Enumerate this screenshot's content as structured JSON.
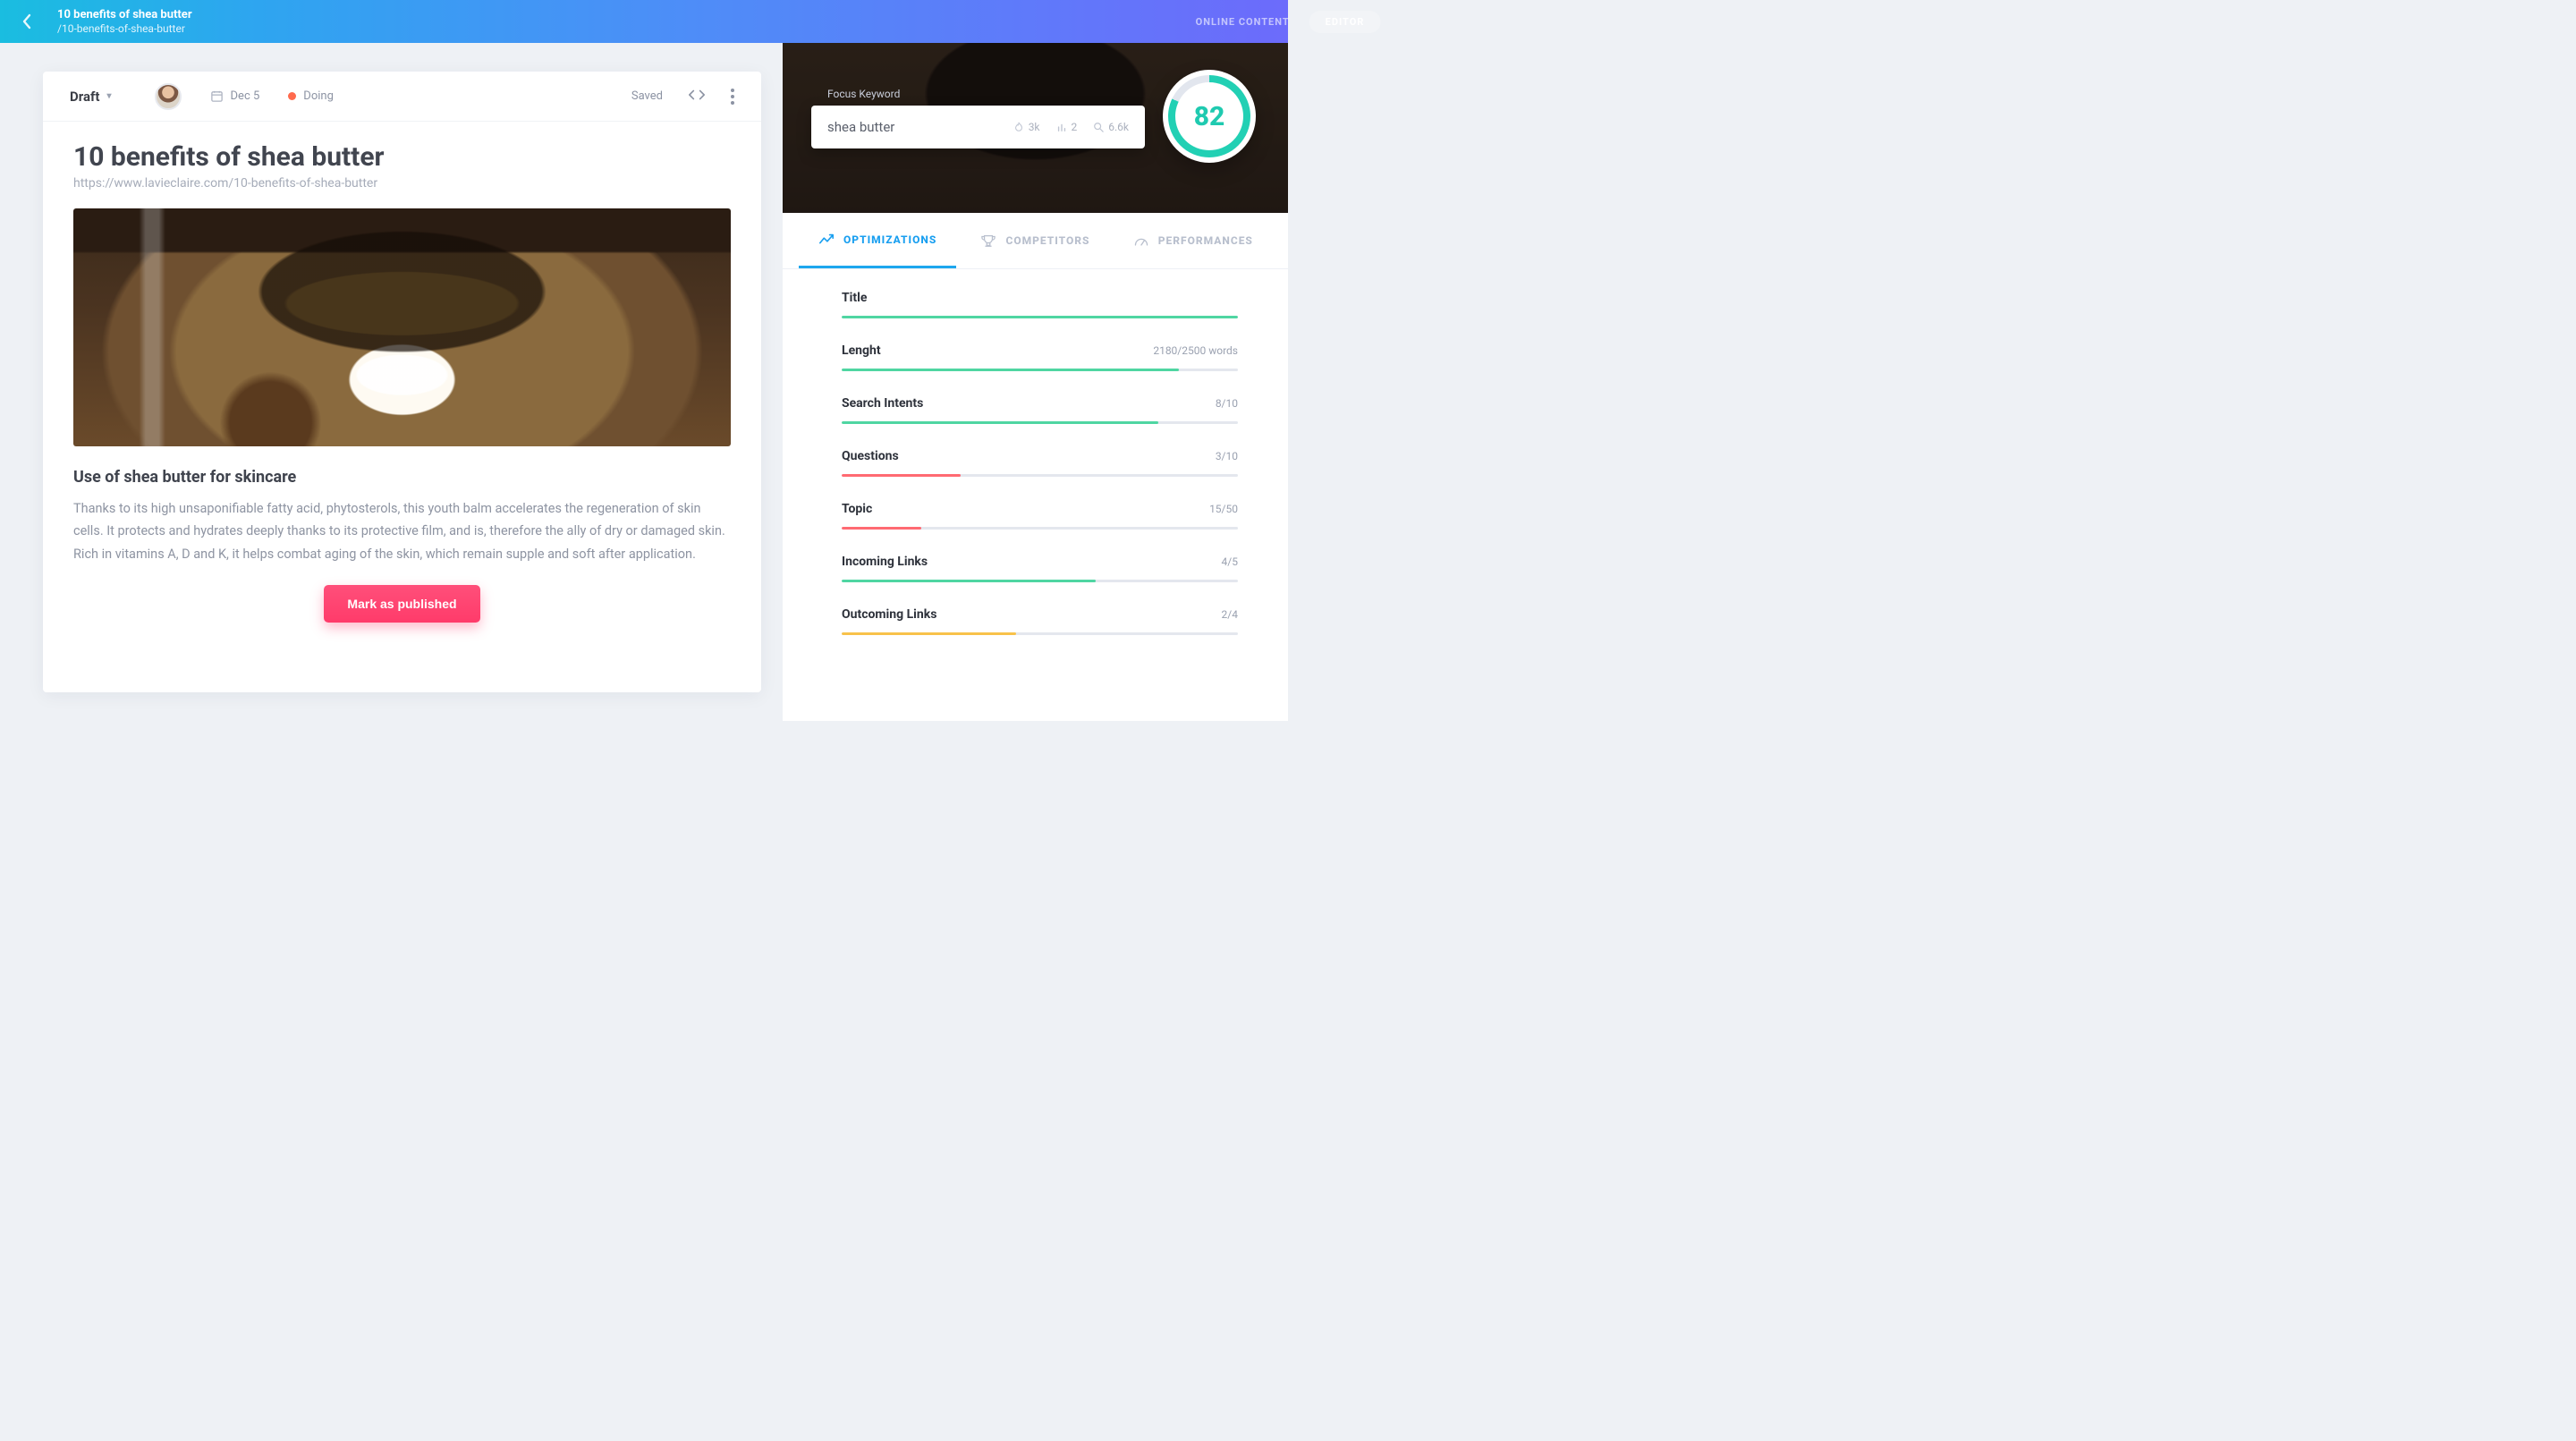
{
  "header": {
    "title": "10 benefits of shea butter",
    "slug": "/10-benefits-of-shea-butter",
    "tabs": {
      "online_content": "ONLINE CONTENT",
      "editor": "EDITOR"
    }
  },
  "editor": {
    "draft_label": "Draft",
    "date_label": "Dec 5",
    "status_label": "Doing",
    "saved_label": "Saved",
    "article": {
      "title": "10 benefits of shea butter",
      "url": "https://www.lavieclaire.com/10-benefits-of-shea-butter",
      "subtitle": "Use of shea butter for skincare",
      "body": "Thanks to its high unsaponifiable fatty acid, phytosterols, this youth balm accelerates the regeneration of skin cells. It protects and hydrates deeply thanks to its protective film, and is, therefore the ally of dry or damaged skin. Rich in vitamins A, D and K, it helps combat aging of the skin, which remain supple and soft after application."
    },
    "publish_label": "Mark as published"
  },
  "seo": {
    "focus_label": "Focus Keyword",
    "keyword": "shea butter",
    "stats": {
      "fire": "3k",
      "rank": "2",
      "search": "6.6k"
    },
    "score": "82",
    "tabs": {
      "optimizations": "OPTIMIZATIONS",
      "competitors": "COMPETITORS",
      "performances": "PERFORMANCES"
    },
    "optimizations": [
      {
        "label": "Title",
        "value": "",
        "pct": 100,
        "color": "green"
      },
      {
        "label": "Lenght",
        "value": "2180/2500 words",
        "pct": 85,
        "color": "green"
      },
      {
        "label": "Search Intents",
        "value": "8/10",
        "pct": 80,
        "color": "green"
      },
      {
        "label": "Questions",
        "value": "3/10",
        "pct": 30,
        "color": "red"
      },
      {
        "label": "Topic",
        "value": "15/50",
        "pct": 20,
        "color": "red"
      },
      {
        "label": "Incoming Links",
        "value": "4/5",
        "pct": 64,
        "color": "green"
      },
      {
        "label": "Outcoming Links",
        "value": "2/4",
        "pct": 44,
        "color": "yellow"
      }
    ]
  }
}
